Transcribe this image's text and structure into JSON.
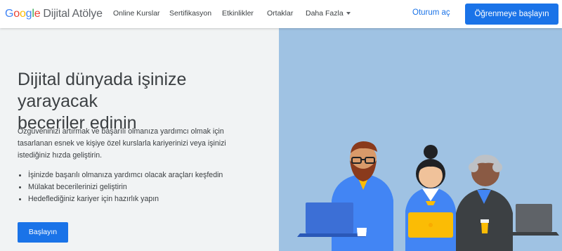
{
  "header": {
    "logo": {
      "letters": [
        "G",
        "o",
        "o",
        "g",
        "l",
        "e"
      ],
      "suffix": "Dijital Atölye"
    },
    "nav": [
      "Online Kurslar",
      "Sertifikasyon",
      "Etkinlikler",
      "Ortaklar"
    ],
    "more_label": "Daha Fazla",
    "signin_label": "Oturum aç",
    "cta_label": "Öğrenmeye başlayın"
  },
  "hero": {
    "title_line1": "Dijital dünyada işinize yarayacak",
    "title_line2": "beceriler edinin",
    "description": "Özgüveninizi artırmak ve başarılı olmanıza yardımcı olmak için tasarlanan esnek ve kişiye özel kurslarla kariyerinizi veya işinizi istediğiniz hızda geliştirin.",
    "bullets": [
      "İşinizde başarılı olmanıza yardımcı olacak araçları keşfedin",
      "Mülakat becerilerinizi geliştirin",
      "Hedeflediğiniz kariyer için hazırlık yapın"
    ],
    "button_label": "Başlayın"
  },
  "colors": {
    "accent": "#1a73e8",
    "google_blue": "#4285f4",
    "google_red": "#ea4335",
    "google_yellow": "#fbbc05",
    "google_green": "#34a853",
    "illustration_bg": "#9fc2e3"
  }
}
